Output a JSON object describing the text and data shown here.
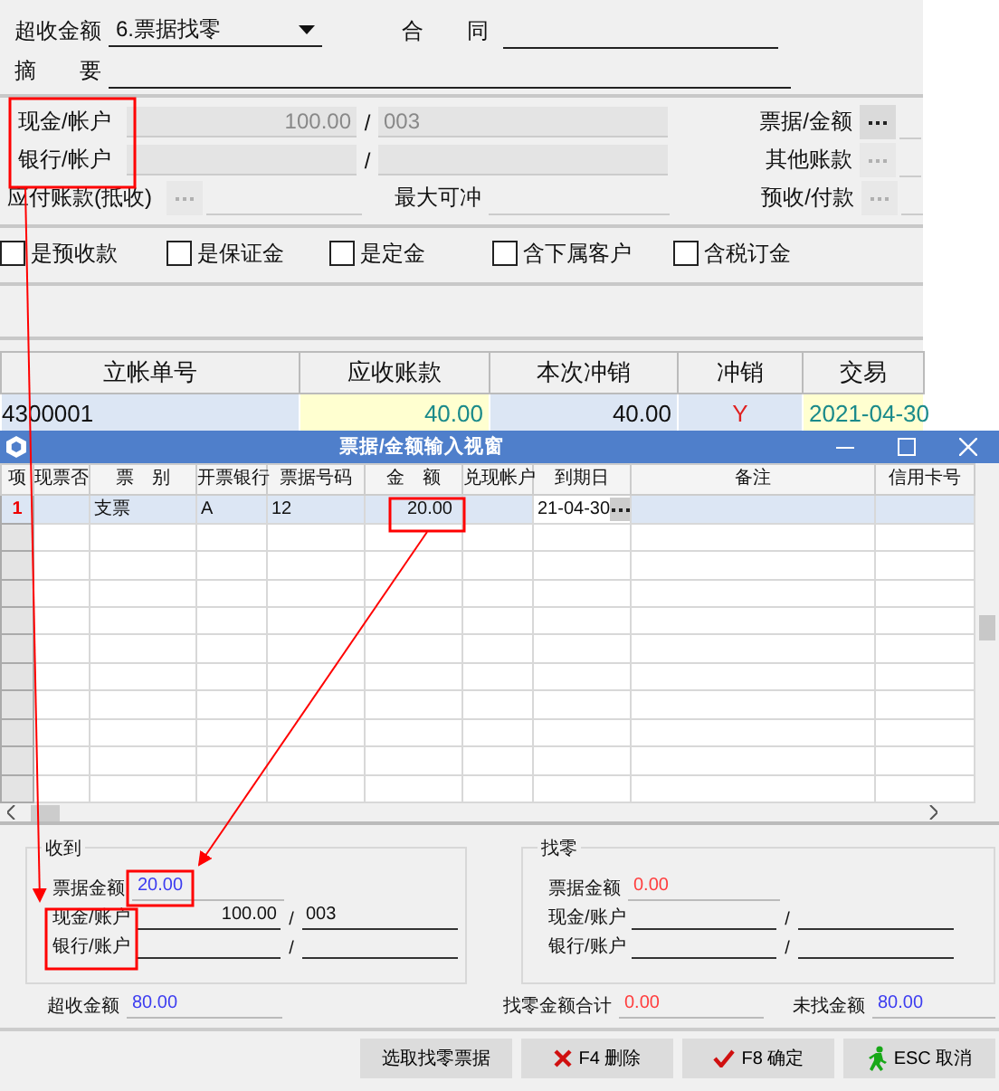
{
  "main_form": {
    "overpay_label": "超收金额",
    "overpay_mode": "6.票据找零",
    "contract_label": "合　　同",
    "summary_label": "摘　　要",
    "account_rows": [
      {
        "label": "现金/帐户",
        "amount": "100.00",
        "separator": "/",
        "account": "003",
        "side_label": "票据/金额",
        "side_disabled": false
      },
      {
        "label": "银行/帐户",
        "amount": "",
        "separator": "/",
        "account": "",
        "side_label": "其他账款",
        "side_disabled": true
      }
    ],
    "payable_label": "应付账款(抵收)",
    "max_offset_label": "最大可冲",
    "prepay_label": "预收/付款",
    "prepay_disabled": true,
    "checks": [
      {
        "label": "是预收款",
        "checked": false
      },
      {
        "label": "是保证金",
        "checked": false
      },
      {
        "label": "是定金",
        "checked": false
      },
      {
        "label": "含下属客户",
        "checked": false
      },
      {
        "label": "含税订金",
        "checked": false
      }
    ]
  },
  "ledger_table": {
    "columns": [
      "立帐单号",
      "应收账款",
      "本次冲销",
      "冲销",
      "交易"
    ],
    "rows": [
      {
        "cells": [
          "4300001",
          "40.00",
          "40.00",
          "Y",
          "2021-04-30"
        ]
      }
    ]
  },
  "dialog": {
    "title": "票据/金额输入视窗",
    "grid": {
      "columns": [
        "项",
        "现票否",
        "票　别",
        "开票银行",
        "票据号码",
        "金　额",
        "兑现帐户",
        "到期日",
        "备注",
        "信用卡号"
      ],
      "rows": [
        {
          "selected": true,
          "cells": [
            "1",
            "",
            "支票",
            "A",
            "12",
            "20.00",
            "",
            "21-04-30",
            "",
            ""
          ]
        }
      ]
    },
    "received": {
      "title": "收到",
      "bill": {
        "label": "票据金额",
        "value": "20.00",
        "color": "#3c3cf0"
      },
      "rows": [
        {
          "label": "现金/账户",
          "amount": "100.00",
          "separator": "/",
          "account": "003"
        },
        {
          "label": "银行/账户",
          "amount": "",
          "separator": "/",
          "account": ""
        }
      ]
    },
    "change": {
      "title": "找零",
      "bill": {
        "label": "票据金额",
        "value": "0.00",
        "color": "#ff3c3c"
      },
      "rows": [
        {
          "label": "现金/账户",
          "amount": "",
          "separator": "/",
          "account": ""
        },
        {
          "label": "银行/账户",
          "amount": "",
          "separator": "/",
          "account": ""
        }
      ]
    },
    "totals": [
      {
        "label": "超收金额",
        "value": "80.00",
        "color": "#3c3cf0"
      },
      {
        "label": "找零金额合计",
        "value": "0.00",
        "color": "#ff3c3c"
      },
      {
        "label": "未找金额",
        "value": "80.00",
        "color": "#3c3cf0"
      }
    ],
    "buttons": [
      {
        "label": "选取找零票据",
        "kind": "plain"
      },
      {
        "label": "F4 删除",
        "kind": "delete"
      },
      {
        "label": "F8 确定",
        "kind": "confirm"
      },
      {
        "label": "ESC 取消",
        "kind": "cancel"
      }
    ]
  }
}
